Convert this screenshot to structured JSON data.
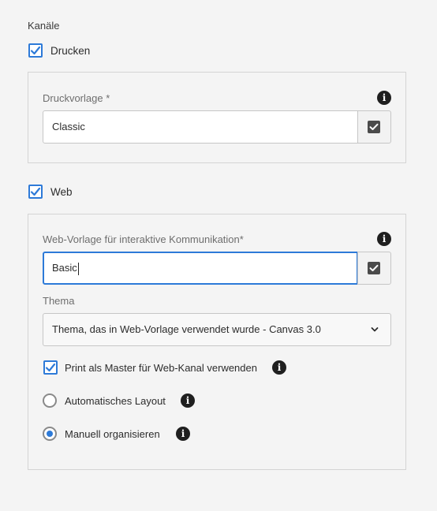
{
  "channels": {
    "heading": "Kanäle",
    "print": {
      "label": "Drucken",
      "checked": true,
      "template_label": "Druckvorlage *",
      "template_value": "Classic"
    },
    "web": {
      "label": "Web",
      "checked": true,
      "template_label": "Web-Vorlage für interaktive Kommunikation*",
      "template_value": "Basic",
      "theme_label": "Thema",
      "theme_value": "Thema, das in Web-Vorlage verwendet wurde - Canvas 3.0",
      "print_as_master_label": "Print als Master für Web-Kanal verwenden",
      "print_as_master_checked": true,
      "layout_options": [
        {
          "label": "Automatisches Layout",
          "selected": false
        },
        {
          "label": "Manuell organisieren",
          "selected": true
        }
      ]
    }
  },
  "colors": {
    "accent": "#2d7ad8",
    "background": "#f4f4f4"
  },
  "icons": {
    "info": "info-icon",
    "checkmark": "checkmark-icon",
    "chevron": "chevron-down-icon"
  }
}
